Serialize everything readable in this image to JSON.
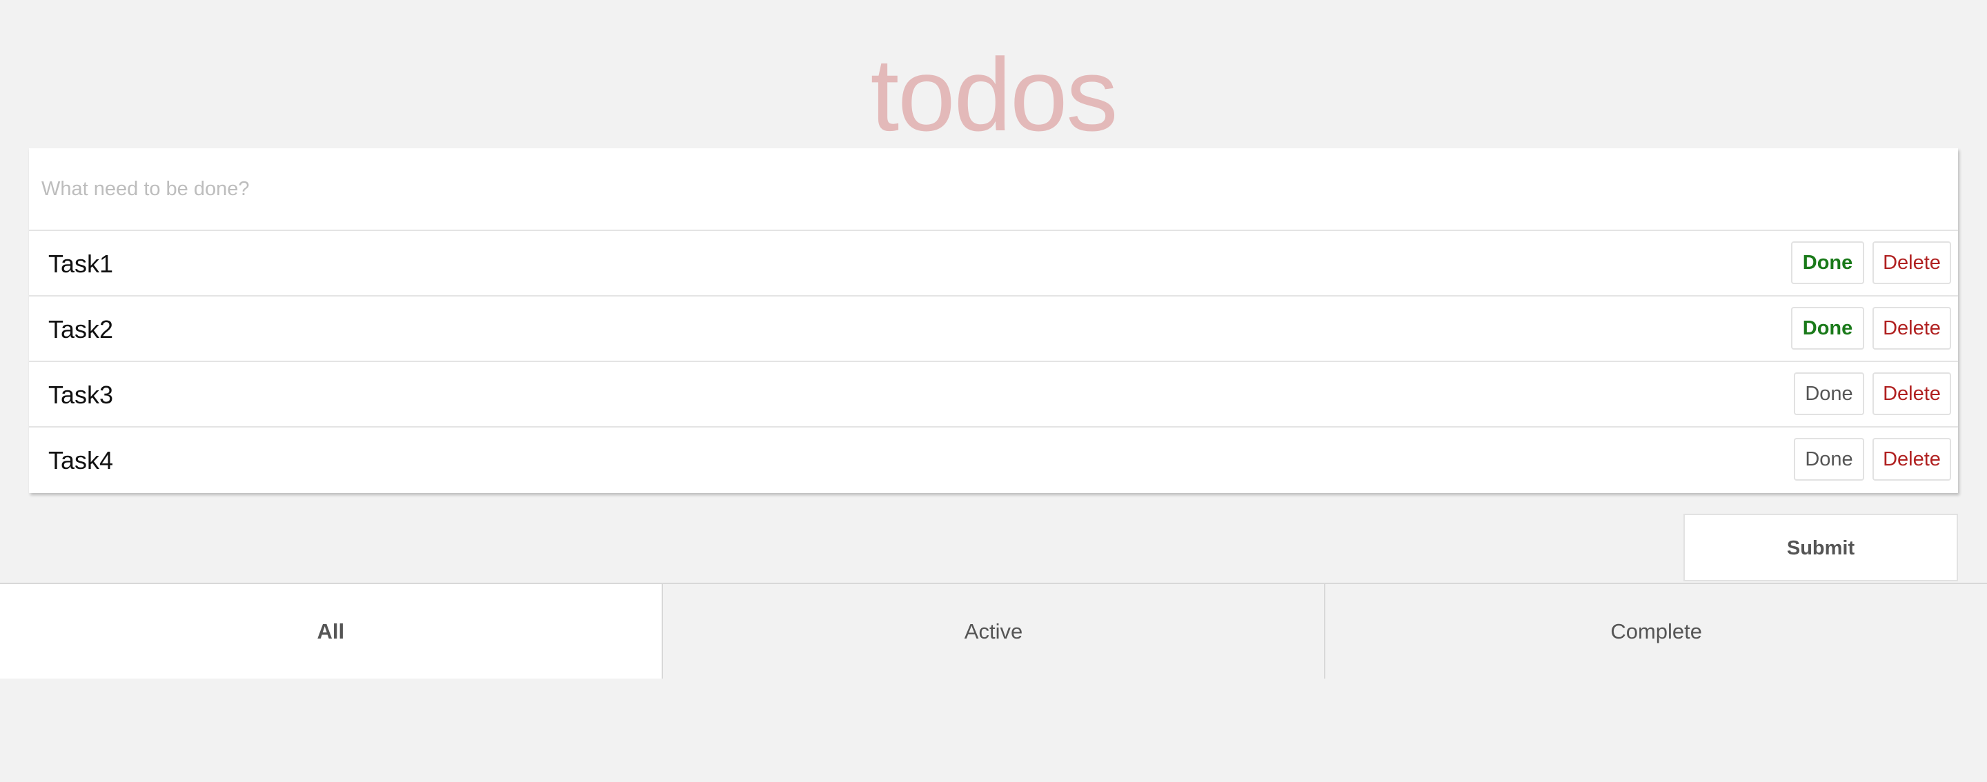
{
  "header": {
    "title": "todos"
  },
  "new_todo": {
    "placeholder": "What need to be done?",
    "value": ""
  },
  "todos": [
    {
      "label": "Task1",
      "done_label": "Done",
      "delete_label": "Delete",
      "done": true
    },
    {
      "label": "Task2",
      "done_label": "Done",
      "delete_label": "Delete",
      "done": true
    },
    {
      "label": "Task3",
      "done_label": "Done",
      "delete_label": "Delete",
      "done": false
    },
    {
      "label": "Task4",
      "done_label": "Done",
      "delete_label": "Delete",
      "done": false
    }
  ],
  "submit": {
    "label": "Submit"
  },
  "filters": {
    "items": [
      "All",
      "Active",
      "Complete"
    ],
    "selected": "All"
  },
  "colors": {
    "title": "#e3b9b9",
    "done_active": "#1a7a1a",
    "delete": "#b02020",
    "background": "#f2f2f2"
  }
}
